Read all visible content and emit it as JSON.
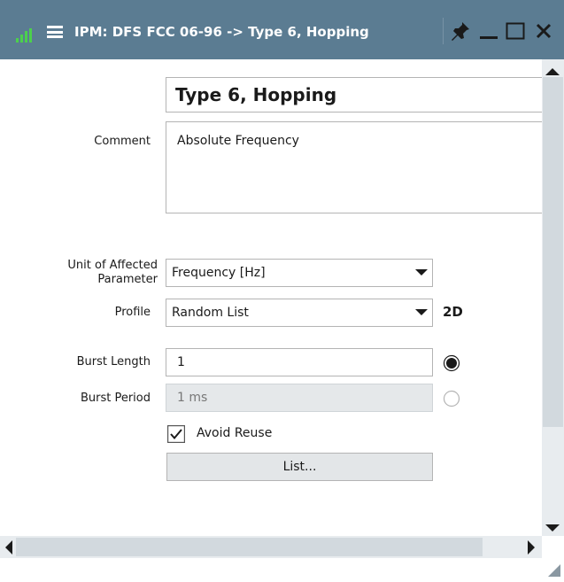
{
  "window": {
    "title": "IPM: DFS FCC 06-96 -> Type 6, Hopping",
    "accent_color": "#5b7c92",
    "icons": [
      "signal-icon",
      "menu-icon",
      "pin-icon",
      "minimize-icon",
      "maximize-icon",
      "close-icon"
    ]
  },
  "form": {
    "name_value": "Type 6, Hopping",
    "comment_label": "Comment",
    "comment_value": "Absolute Frequency",
    "unit_label": "Unit of Affected Parameter",
    "unit_value": "Frequency [Hz]",
    "profile_label": "Profile",
    "profile_value": "Random List",
    "profile_tag": "2D",
    "burst_length_label": "Burst Length",
    "burst_length_value": "1",
    "burst_length_selected": true,
    "burst_period_label": "Burst Period",
    "burst_period_value": "1 ms",
    "burst_period_selected": false,
    "avoid_reuse_label": "Avoid Reuse",
    "avoid_reuse_checked": true,
    "list_button_label": "List..."
  }
}
